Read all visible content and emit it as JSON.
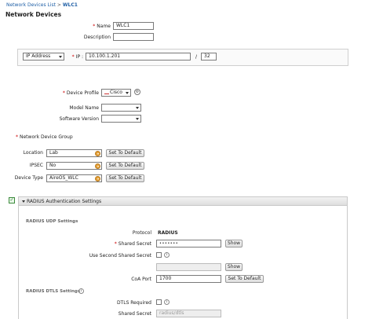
{
  "breadcrumb": {
    "parent": "Network Devices List",
    "separator": ">",
    "current": "WLC1"
  },
  "page_title": "Network Devices",
  "form": {
    "name": {
      "label": "Name",
      "value": "WLC1"
    },
    "description": {
      "label": "Description",
      "value": ""
    },
    "ip_type": {
      "value": "IP Address"
    },
    "ip": {
      "label": "IP :",
      "value": "10.100.1.201"
    },
    "mask_sep": "/",
    "mask": {
      "value": "32"
    },
    "device_profile": {
      "label": "Device Profile",
      "value": "Cisco"
    },
    "model_name": {
      "label": "Model Name",
      "value": ""
    },
    "software_version": {
      "label": "Software Version",
      "value": ""
    },
    "ndg_title": "Network Device Group",
    "groups": [
      {
        "label": "Location",
        "value": "Lab",
        "button": "Set To Default"
      },
      {
        "label": "IPSEC",
        "value": "No",
        "button": "Set To Default"
      },
      {
        "label": "Device Type",
        "value": "AireOS_WLC",
        "button": "Set To Default"
      }
    ]
  },
  "radius": {
    "enabled": true,
    "header": "RADIUS Authentication Settings",
    "udp_title": "RADIUS UDP Settings",
    "protocol_label": "Protocol",
    "protocol_value": "RADIUS",
    "shared_secret_label": "Shared Secret",
    "shared_secret_value": "•••••••",
    "show_label": "Show",
    "use_second_label": "Use Second Shared Secret",
    "second_secret_value": "",
    "show2_label": "Show",
    "coa_label": "CoA Port",
    "coa_value": "1700",
    "coa_button": "Set To Default",
    "dtls_title": "RADIUS DTLS Settings",
    "dtls_required_label": "DTLS Required",
    "dtls_secret_label": "Shared Secret",
    "dtls_secret_value": "radius/dtls"
  },
  "colors": {
    "link": "#1f5fa6",
    "required": "#cc0000",
    "accent_check": "#3a8a3a"
  }
}
